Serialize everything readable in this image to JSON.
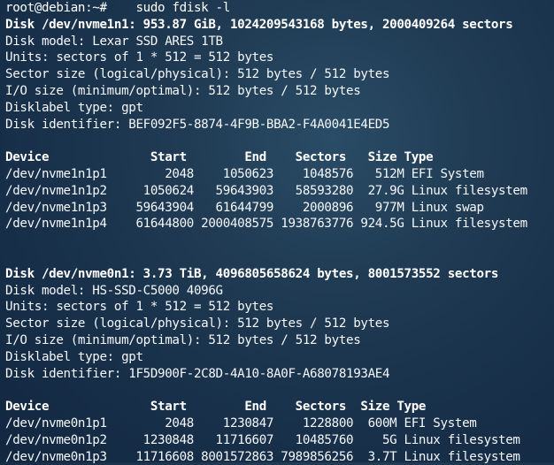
{
  "prompt": "root@debian:~#",
  "command": "    sudo fdisk -l",
  "disks": [
    {
      "header": "Disk /dev/nvme1n1: 953.87 GiB, 1024209543168 bytes, 2000409264 sectors",
      "model": "Disk model: Lexar SSD ARES 1TB",
      "units": "Units: sectors of 1 * 512 = 512 bytes",
      "sector_size": "Sector size (logical/physical): 512 bytes / 512 bytes",
      "io_size": "I/O size (minimum/optimal): 512 bytes / 512 bytes",
      "label_type": "Disklabel type: gpt",
      "identifier": "Disk identifier: BEF092F5-8874-4F9B-BBA2-F4A0041E4ED5",
      "table_header": "Device              Start        End    Sectors   Size Type",
      "rows": [
        "/dev/nvme1n1p1        2048    1050623    1048576   512M EFI System",
        "/dev/nvme1n1p2     1050624   59643903   58593280  27.9G Linux filesystem",
        "/dev/nvme1n1p3    59643904   61644799    2000896   977M Linux swap",
        "/dev/nvme1n1p4    61644800 2000408575 1938763776 924.5G Linux filesystem"
      ]
    },
    {
      "header": "Disk /dev/nvme0n1: 3.73 TiB, 4096805658624 bytes, 8001573552 sectors",
      "model": "Disk model: HS-SSD-C5000 4096G",
      "units": "Units: sectors of 1 * 512 = 512 bytes",
      "sector_size": "Sector size (logical/physical): 512 bytes / 512 bytes",
      "io_size": "I/O size (minimum/optimal): 512 bytes / 512 bytes",
      "label_type": "Disklabel type: gpt",
      "identifier": "Disk identifier: 1F5D900F-2C8D-4A10-8A0F-A68078193AE4",
      "table_header": "Device              Start        End    Sectors  Size Type",
      "rows": [
        "/dev/nvme0n1p1        2048    1230847    1228800  600M EFI System",
        "/dev/nvme0n1p2     1230848   11716607   10485760    5G Linux filesystem",
        "/dev/nvme0n1p3    11716608 8001572863 7989856256  3.7T Linux filesystem"
      ]
    }
  ]
}
